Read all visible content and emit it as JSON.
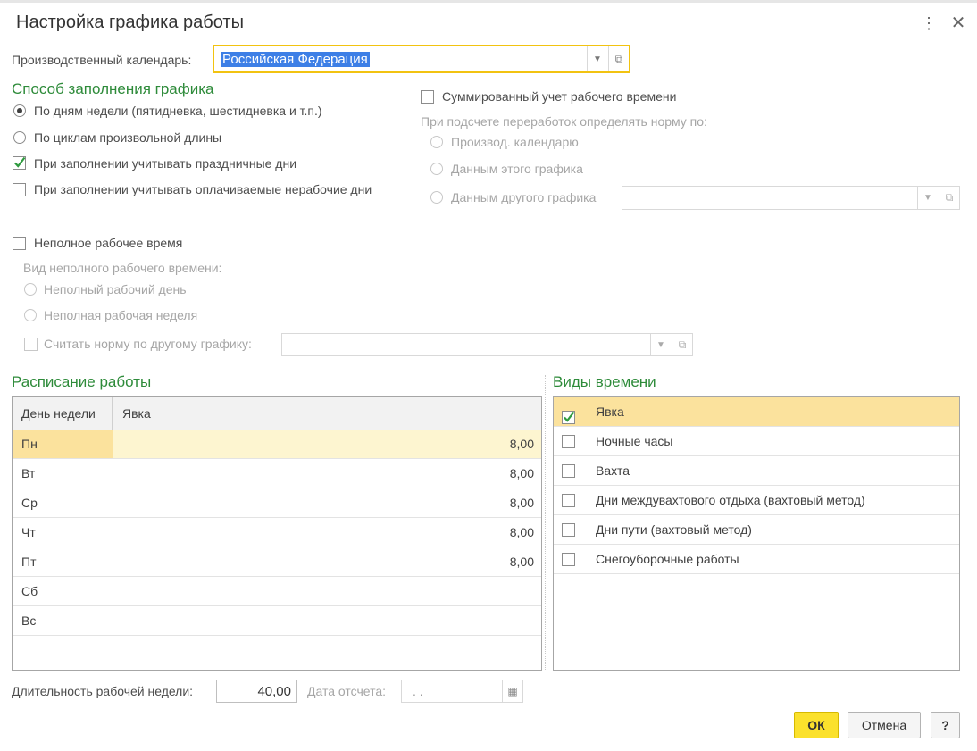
{
  "window": {
    "title": "Настройка графика работы"
  },
  "calendar": {
    "label": "Производственный календарь:",
    "value": "Российская Федерация"
  },
  "fill_method": {
    "heading": "Способ заполнения графика",
    "radio1": "По дням недели (пятидневка, шестидневка и т.п.)",
    "radio2": "По циклам произвольной длины",
    "check_holidays": "При заполнении учитывать праздничные дни",
    "check_paid_off": "При заполнении учитывать оплачиваемые нерабочие дни"
  },
  "summary": {
    "check_label": "Суммированный учет рабочего времени",
    "norm_label": "При подсчете переработок определять норму по:",
    "opt1": "Производ. календарю",
    "opt2": "Данным этого графика",
    "opt3": "Данным другого графика"
  },
  "part_time": {
    "check_label": "Неполное рабочее время",
    "kind_label": "Вид неполного рабочего времени:",
    "opt1": "Неполный рабочий день",
    "opt2": "Неполная рабочая неделя",
    "other_label": "Считать норму по другому графику:"
  },
  "schedule": {
    "heading": "Расписание работы",
    "col_day": "День недели",
    "col_value": "Явка",
    "rows": [
      {
        "day": "Пн",
        "value": "8,00"
      },
      {
        "day": "Вт",
        "value": "8,00"
      },
      {
        "day": "Ср",
        "value": "8,00"
      },
      {
        "day": "Чт",
        "value": "8,00"
      },
      {
        "day": "Пт",
        "value": "8,00"
      },
      {
        "day": "Сб",
        "value": ""
      },
      {
        "day": "Вс",
        "value": ""
      }
    ]
  },
  "time_types": {
    "heading": "Виды времени",
    "items": [
      {
        "label": "Явка",
        "checked": true
      },
      {
        "label": "Ночные часы",
        "checked": false
      },
      {
        "label": "Вахта",
        "checked": false
      },
      {
        "label": "Дни междувахтового отдыха (вахтовый метод)",
        "checked": false
      },
      {
        "label": "Дни пути (вахтовый метод)",
        "checked": false
      },
      {
        "label": "Снегоуборочные работы",
        "checked": false
      }
    ]
  },
  "footer": {
    "week_length_label": "Длительность рабочей недели:",
    "week_length_value": "40,00",
    "ref_date_label": "Дата отсчета:",
    "ref_date_value": ". ."
  },
  "buttons": {
    "ok": "ОК",
    "cancel": "Отмена",
    "help": "?"
  },
  "colors": {
    "section": "#2e8b3a",
    "accent": "#fbe12c",
    "selection": "#3d7fe6",
    "row_highlight": "#fbe29d"
  }
}
